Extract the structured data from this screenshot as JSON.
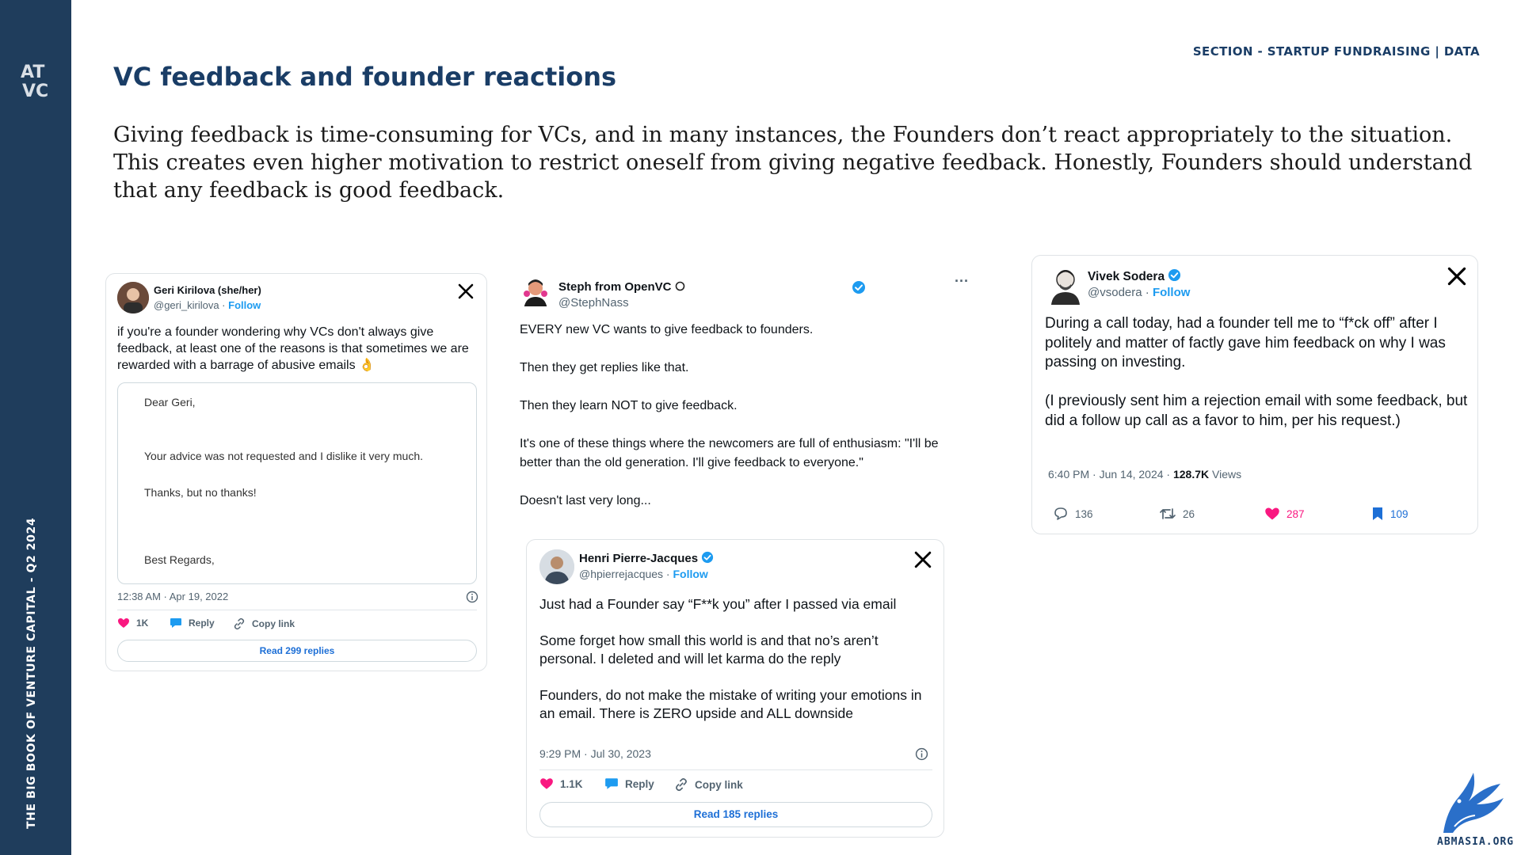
{
  "sidebar": {
    "vertical_text": "THE BIG BOOK OF VENTURE CAPITAL - Q2 2024",
    "logo_text_top": "AT",
    "logo_text_bottom": "VC"
  },
  "header": {
    "section_tag": "SECTION - STARTUP FUNDRAISING | DATA",
    "title": "VC feedback and founder reactions",
    "intro": "Giving feedback is time-consuming for VCs, and in many instances, the Founders don’t react appropriately to the situation. This creates even higher motivation to restrict oneself from giving negative feedback. Honestly, Founders should understand that any feedback is good feedback."
  },
  "tweets": [
    {
      "name": "Geri Kirilova (she/her)",
      "handle": "@geri_kirilova",
      "follow": "Follow",
      "text": "if you're a founder wondering why VCs don't always give feedback, at least one of the reasons is that sometimes we are rewarded with a barrage of abusive emails 👌",
      "email": {
        "greeting": "Dear Geri,",
        "line1": "Your advice was not requested and I dislike it very much.",
        "line2": "Thanks, but no thanks!",
        "signoff": "Best Regards,"
      },
      "timestamp": "12:38 AM · Apr 19, 2022",
      "likes": "1K",
      "reply": "Reply",
      "copy": "Copy link",
      "read": "Read 299 replies"
    },
    {
      "name": "Steph from OpenVC",
      "handle": "@StephNass",
      "more": "···",
      "paragraphs": [
        "EVERY new VC wants to give feedback to founders.",
        "Then they get replies like that.",
        "Then they learn NOT to give feedback.",
        "It's one of these things where the newcomers are full of enthusiasm: \"I'll be better than the old generation. I'll give feedback to everyone.\"",
        "Doesn't last very long..."
      ]
    },
    {
      "name": "Henri Pierre-Jacques",
      "handle": "@hpierrejacques",
      "follow": "Follow",
      "paragraphs": [
        "Just had a Founder say “F**k you” after I passed via email",
        "Some forget how small this world is and that no’s aren’t personal. I deleted and will let karma do the reply",
        "Founders, do not make the mistake of writing your emotions in an email. There is ZERO upside and ALL downside"
      ],
      "timestamp": "9:29 PM · Jul 30, 2023",
      "likes": "1.1K",
      "reply": "Reply",
      "copy": "Copy link",
      "read": "Read 185 replies"
    },
    {
      "name": "Vivek Sodera",
      "handle": "@vsodera",
      "follow": "Follow",
      "paragraphs": [
        "During a call today, had a founder tell me to “f*ck off” after I politely and matter of factly gave him feedback on why I was passing on investing.",
        "(I previously sent him a rejection email with some feedback, but did a follow up call as a favor to him, per his request.)"
      ],
      "time": "6:40 PM · Jun 14, 2024 · ",
      "views_count": "128.7K",
      "views_label": " Views",
      "replies": "136",
      "retweets": "26",
      "likes": "287",
      "bookmarks": "109"
    }
  ],
  "footer": {
    "brand": "ABMASIA.ORG"
  },
  "colors": {
    "navy": "#1f3d5c",
    "title_blue": "#1a3d66",
    "link_blue": "#1d9bf0",
    "like_pink": "#f91880"
  }
}
